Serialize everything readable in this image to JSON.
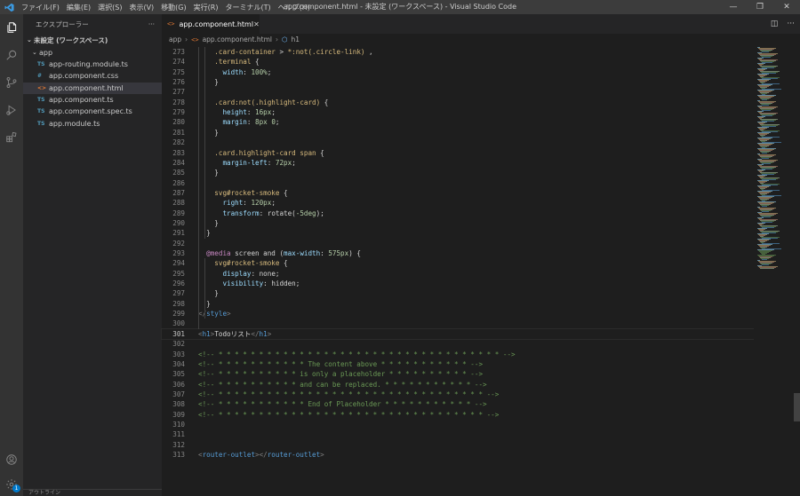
{
  "window": {
    "title": "app.component.html - 未設定 (ワークスペース) - Visual Studio Code",
    "logo": "vscode-logo",
    "menu": [
      "ファイル(F)",
      "編集(E)",
      "選択(S)",
      "表示(V)",
      "移動(G)",
      "実行(R)",
      "ターミナル(T)",
      "ヘルプ(H)"
    ],
    "controls": {
      "minimize": "—",
      "restore": "❐",
      "close": "✕"
    }
  },
  "activity_bar": {
    "items": [
      "files-icon",
      "search-icon",
      "source-control-icon",
      "run-debug-icon",
      "extensions-icon"
    ],
    "bottom": [
      "account-icon",
      "settings-gear-icon"
    ],
    "settings_badge": "1"
  },
  "sidebar": {
    "title": "エクスプローラー",
    "more": "···",
    "workspace": "未設定 (ワークスペース)",
    "folder": "app",
    "files": [
      {
        "icon": "TS",
        "icon_color": "#519aba",
        "name": "app-routing.module.ts",
        "active": false
      },
      {
        "icon": "#",
        "icon_color": "#519aba",
        "name": "app.component.css",
        "active": false
      },
      {
        "icon": "<>",
        "icon_color": "#e37933",
        "name": "app.component.html",
        "active": true
      },
      {
        "icon": "TS",
        "icon_color": "#519aba",
        "name": "app.component.ts",
        "active": false
      },
      {
        "icon": "TS",
        "icon_color": "#519aba",
        "name": "app.component.spec.ts",
        "active": false
      },
      {
        "icon": "TS",
        "icon_color": "#519aba",
        "name": "app.module.ts",
        "active": false
      }
    ],
    "outline_label": "アウトライン"
  },
  "tabs": [
    {
      "label": "app.component.html",
      "icon": "<>",
      "close": "✕",
      "active": true
    }
  ],
  "tab_actions": {
    "split": "◫",
    "more": "···"
  },
  "breadcrumb": {
    "items": [
      "app",
      "app.component.html",
      "h1"
    ],
    "separator": "›"
  },
  "editor": {
    "current_line": 301,
    "lines": [
      {
        "n": 273,
        "tokens": [
          [
            "    ",
            "t-punc"
          ],
          [
            ".card-container",
            "t-sel"
          ],
          [
            " > ",
            "t-punc"
          ],
          [
            "*:not(.circle-link)",
            "t-sel"
          ],
          [
            " ,",
            "t-punc"
          ]
        ]
      },
      {
        "n": 274,
        "tokens": [
          [
            "    ",
            "t-punc"
          ],
          [
            ".terminal",
            "t-sel"
          ],
          [
            " {",
            "t-punc"
          ]
        ]
      },
      {
        "n": 275,
        "tokens": [
          [
            "      ",
            "t-punc"
          ],
          [
            "width",
            "t-prop"
          ],
          [
            ": ",
            "t-punc"
          ],
          [
            "100%",
            "t-num"
          ],
          [
            ";",
            "t-punc"
          ]
        ]
      },
      {
        "n": 276,
        "tokens": [
          [
            "    }",
            "t-punc"
          ]
        ]
      },
      {
        "n": 277,
        "tokens": []
      },
      {
        "n": 278,
        "tokens": [
          [
            "    ",
            "t-punc"
          ],
          [
            ".card:not(.highlight-card)",
            "t-sel"
          ],
          [
            " {",
            "t-punc"
          ]
        ]
      },
      {
        "n": 279,
        "tokens": [
          [
            "      ",
            "t-punc"
          ],
          [
            "height",
            "t-prop"
          ],
          [
            ": ",
            "t-punc"
          ],
          [
            "16px",
            "t-num"
          ],
          [
            ";",
            "t-punc"
          ]
        ]
      },
      {
        "n": 280,
        "tokens": [
          [
            "      ",
            "t-punc"
          ],
          [
            "margin",
            "t-prop"
          ],
          [
            ": ",
            "t-punc"
          ],
          [
            "8px 0",
            "t-num"
          ],
          [
            ";",
            "t-punc"
          ]
        ]
      },
      {
        "n": 281,
        "tokens": [
          [
            "    }",
            "t-punc"
          ]
        ]
      },
      {
        "n": 282,
        "tokens": []
      },
      {
        "n": 283,
        "tokens": [
          [
            "    ",
            "t-punc"
          ],
          [
            ".card.highlight-card span",
            "t-sel"
          ],
          [
            " {",
            "t-punc"
          ]
        ]
      },
      {
        "n": 284,
        "tokens": [
          [
            "      ",
            "t-punc"
          ],
          [
            "margin-left",
            "t-prop"
          ],
          [
            ": ",
            "t-punc"
          ],
          [
            "72px",
            "t-num"
          ],
          [
            ";",
            "t-punc"
          ]
        ]
      },
      {
        "n": 285,
        "tokens": [
          [
            "    }",
            "t-punc"
          ]
        ]
      },
      {
        "n": 286,
        "tokens": []
      },
      {
        "n": 287,
        "tokens": [
          [
            "    ",
            "t-punc"
          ],
          [
            "svg#rocket-smoke",
            "t-sel"
          ],
          [
            " {",
            "t-punc"
          ]
        ]
      },
      {
        "n": 288,
        "tokens": [
          [
            "      ",
            "t-punc"
          ],
          [
            "right",
            "t-prop"
          ],
          [
            ": ",
            "t-punc"
          ],
          [
            "120px",
            "t-num"
          ],
          [
            ";",
            "t-punc"
          ]
        ]
      },
      {
        "n": 289,
        "tokens": [
          [
            "      ",
            "t-punc"
          ],
          [
            "transform",
            "t-prop"
          ],
          [
            ": ",
            "t-punc"
          ],
          [
            "rotate(",
            "t-text"
          ],
          [
            "-5deg",
            "t-num"
          ],
          [
            ");",
            "t-punc"
          ]
        ]
      },
      {
        "n": 290,
        "tokens": [
          [
            "    }",
            "t-punc"
          ]
        ]
      },
      {
        "n": 291,
        "tokens": [
          [
            "  }",
            "t-punc"
          ]
        ]
      },
      {
        "n": 292,
        "tokens": []
      },
      {
        "n": 293,
        "tokens": [
          [
            "  ",
            "t-punc"
          ],
          [
            "@media",
            "t-at"
          ],
          [
            " screen and (",
            "t-text"
          ],
          [
            "max-width",
            "t-prop"
          ],
          [
            ": ",
            "t-punc"
          ],
          [
            "575px",
            "t-num"
          ],
          [
            ") {",
            "t-punc"
          ]
        ]
      },
      {
        "n": 294,
        "tokens": [
          [
            "    ",
            "t-punc"
          ],
          [
            "svg#rocket-smoke",
            "t-sel"
          ],
          [
            " {",
            "t-punc"
          ]
        ]
      },
      {
        "n": 295,
        "tokens": [
          [
            "      ",
            "t-punc"
          ],
          [
            "display",
            "t-prop"
          ],
          [
            ": ",
            "t-punc"
          ],
          [
            "none",
            "t-text"
          ],
          [
            ";",
            "t-punc"
          ]
        ]
      },
      {
        "n": 296,
        "tokens": [
          [
            "      ",
            "t-punc"
          ],
          [
            "visibility",
            "t-prop"
          ],
          [
            ": ",
            "t-punc"
          ],
          [
            "hidden",
            "t-text"
          ],
          [
            ";",
            "t-punc"
          ]
        ]
      },
      {
        "n": 297,
        "tokens": [
          [
            "    }",
            "t-punc"
          ]
        ]
      },
      {
        "n": 298,
        "tokens": [
          [
            "  }",
            "t-punc"
          ]
        ]
      },
      {
        "n": 299,
        "tokens": [
          [
            "</",
            "t-ang"
          ],
          [
            "style",
            "t-tag"
          ],
          [
            ">",
            "t-ang"
          ]
        ]
      },
      {
        "n": 300,
        "tokens": []
      },
      {
        "n": 301,
        "tokens": [
          [
            "<",
            "t-ang"
          ],
          [
            "h1",
            "t-tag"
          ],
          [
            ">",
            "t-ang"
          ],
          [
            "Todoリスト",
            "t-text"
          ],
          [
            "</",
            "t-ang"
          ],
          [
            "h1",
            "t-tag"
          ],
          [
            ">",
            "t-ang"
          ]
        ]
      },
      {
        "n": 302,
        "tokens": []
      },
      {
        "n": 303,
        "tokens": [
          [
            "<!-- * * * * * * * * * * * * * * * * * * * * * * * * * * * * * * * * * * * -->",
            "t-cmt"
          ]
        ]
      },
      {
        "n": 304,
        "tokens": [
          [
            "<!-- * * * * * * * * * * * The content above * * * * * * * * * * * -->",
            "t-cmt"
          ]
        ]
      },
      {
        "n": 305,
        "tokens": [
          [
            "<!-- * * * * * * * * * * is only a placeholder * * * * * * * * * * -->",
            "t-cmt"
          ]
        ]
      },
      {
        "n": 306,
        "tokens": [
          [
            "<!-- * * * * * * * * * * and can be replaced. * * * * * * * * * * * -->",
            "t-cmt"
          ]
        ]
      },
      {
        "n": 307,
        "tokens": [
          [
            "<!-- * * * * * * * * * * * * * * * * * * * * * * * * * * * * * * * * * -->",
            "t-cmt"
          ]
        ]
      },
      {
        "n": 308,
        "tokens": [
          [
            "<!-- * * * * * * * * * * * End of Placeholder * * * * * * * * * * * -->",
            "t-cmt"
          ]
        ]
      },
      {
        "n": 309,
        "tokens": [
          [
            "<!-- * * * * * * * * * * * * * * * * * * * * * * * * * * * * * * * * * -->",
            "t-cmt"
          ]
        ]
      },
      {
        "n": 310,
        "tokens": []
      },
      {
        "n": 311,
        "tokens": []
      },
      {
        "n": 312,
        "tokens": []
      },
      {
        "n": 313,
        "tokens": [
          [
            "<",
            "t-ang"
          ],
          [
            "router-outlet",
            "t-tag"
          ],
          [
            "></",
            "t-ang"
          ],
          [
            "router-outlet",
            "t-tag"
          ],
          [
            ">",
            "t-ang"
          ]
        ]
      }
    ]
  },
  "colors": {
    "titlebar": "#3c3c3c",
    "activity_bar": "#333333",
    "sidebar": "#252526",
    "editor": "#1e1e1e",
    "accent": "#007acc"
  }
}
